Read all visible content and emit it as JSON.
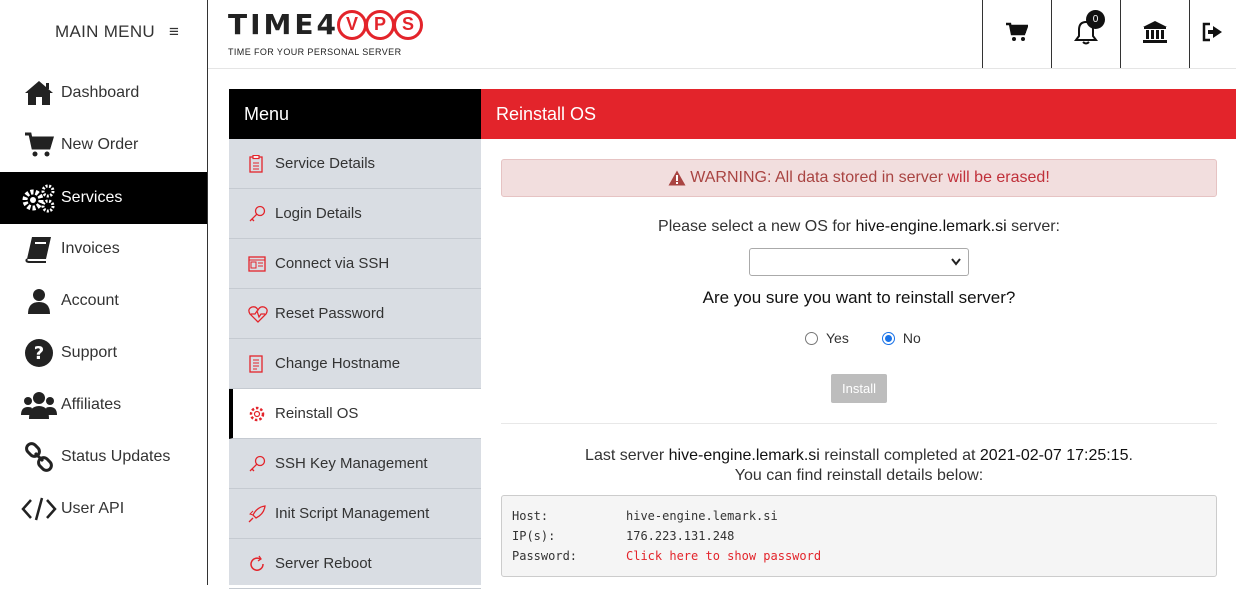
{
  "sidebar": {
    "title": "MAIN MENU",
    "hamburger": "≡",
    "items": [
      {
        "label": "Dashboard",
        "icon": "home-icon"
      },
      {
        "label": "New Order",
        "icon": "cart-icon"
      },
      {
        "label": "Services",
        "icon": "gears-icon"
      },
      {
        "label": "Invoices",
        "icon": "book-icon"
      },
      {
        "label": "Account",
        "icon": "user-icon"
      },
      {
        "label": "Support",
        "icon": "question-icon"
      },
      {
        "label": "Affiliates",
        "icon": "users-icon"
      },
      {
        "label": "Status Updates",
        "icon": "link-icon"
      },
      {
        "label": "User API",
        "icon": "code-icon"
      }
    ]
  },
  "topbar": {
    "logo_word": "TIME4",
    "logo_letters": [
      "V",
      "P",
      "S"
    ],
    "logo_tagline": "TIME FOR YOUR PERSONAL SERVER",
    "notification_count": "0"
  },
  "submenu": {
    "title": "Menu",
    "items": [
      {
        "label": "Service Details"
      },
      {
        "label": "Login Details"
      },
      {
        "label": "Connect via SSH"
      },
      {
        "label": "Reset Password"
      },
      {
        "label": "Change Hostname"
      },
      {
        "label": "Reinstall OS"
      },
      {
        "label": "SSH Key Management"
      },
      {
        "label": "Init Script Management"
      },
      {
        "label": "Server Reboot"
      }
    ]
  },
  "main": {
    "title": "Reinstall OS",
    "warning": {
      "prefix": "WARNING:",
      "middle": " All data stored in server ",
      "emph": "will be erased!"
    },
    "select_prompt": {
      "before": "Please select a new OS for ",
      "server": "hive-engine.lemark.si",
      "after": " server:"
    },
    "os_select_value": "",
    "confirm_question": "Are you sure you want to reinstall server?",
    "radio_yes": "Yes",
    "radio_no": "No",
    "install_label": "Install",
    "last": {
      "before": "Last server ",
      "server": "hive-engine.lemark.si",
      "middle": " reinstall completed at ",
      "time": "2021-02-07 17:25:15",
      "end": ".",
      "line2": "You can find reinstall details below:"
    },
    "details": {
      "host_label": "Host:",
      "host_value": "hive-engine.lemark.si",
      "ip_label": "IP(s):",
      "ip_value": "176.223.131.248",
      "password_label": "Password:",
      "password_value": "Click here to show password"
    }
  },
  "colors": {
    "accent": "#e3242b",
    "active_bg": "#000000",
    "submenu_bg": "#d9dde3"
  }
}
